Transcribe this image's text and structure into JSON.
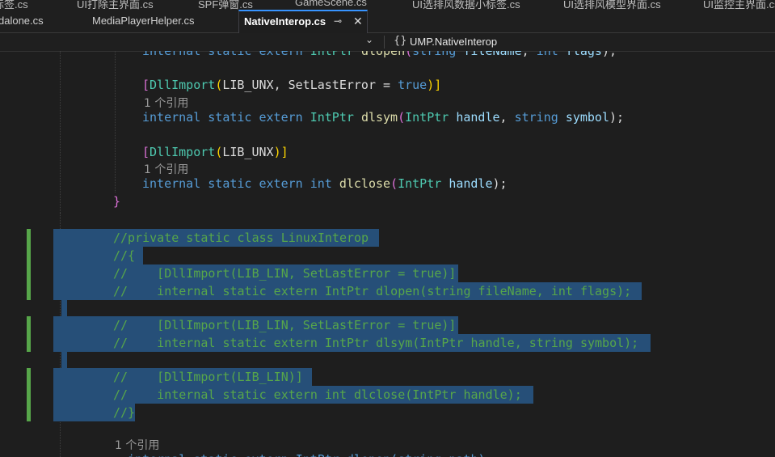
{
  "tabs_row1": [
    "标签.cs",
    "UI打除主界面.cs",
    "SPF弹窗.cs",
    "GameScene.cs",
    "UI选排风数据小标签.cs",
    "UI选排风模型界面.cs",
    "UI监控主界面.cs"
  ],
  "tabs_row2": {
    "tab1": "dalone.cs",
    "tab2": "MediaPlayerHelper.cs",
    "active": "NativeInterop.cs",
    "pin": "⊸",
    "close": "✕"
  },
  "navbar": {
    "dropdown": "⌄",
    "namespace_icon": "{}",
    "namespace": "UMP.NativeInterop"
  },
  "code": {
    "l0": {
      "kw1": "internal",
      "kw2": "static",
      "kw3": "extern",
      "type": "IntPtr",
      "method": "dlopen",
      "p1": "(",
      "kw4": "string",
      "arg1": "fileName",
      "comma": ",",
      "kw5": "int",
      "arg2": "flags",
      "end": ");"
    },
    "l1": {
      "open": "[",
      "attr": "DllImport",
      "p1": "(",
      "lib": "LIB_UNX",
      "comma": ", ",
      "prop": "SetLastError",
      "eq": " = ",
      "val": "true",
      "close": ")]"
    },
    "lens1": "1 个引用",
    "l2": {
      "kw1": "internal",
      "kw2": "static",
      "kw3": "extern",
      "type": "IntPtr",
      "method": "dlsym",
      "p1": "(",
      "type2": "IntPtr",
      "arg1": "handle",
      "comma": ", ",
      "kw4": "string",
      "arg2": "symbol",
      "end": ");"
    },
    "l3": {
      "open": "[",
      "attr": "DllImport",
      "p1": "(",
      "lib": "LIB_UNX",
      "close": ")]"
    },
    "lens2": "1 个引用",
    "l4": {
      "kw1": "internal",
      "kw2": "static",
      "kw3": "extern",
      "kw4": "int",
      "method": "dlclose",
      "p1": "(",
      "type2": "IntPtr",
      "arg1": "handle",
      "end": ");"
    },
    "close_brace": "}",
    "comments": [
      "//private static class LinuxInterop",
      "//{",
      "//    [DllImport(LIB_LIN, SetLastError = true)]",
      "//    internal static extern IntPtr dlopen(string fileName, int flags);",
      "//    [DllImport(LIB_LIN, SetLastError = true)]",
      "//    internal static extern IntPtr dlsym(IntPtr handle, string symbol);",
      "//    [DllImport(LIB_LIN)]",
      "//    internal static extern int dlclose(IntPtr handle);",
      "//}"
    ],
    "lens3": "1 个引用",
    "last_partial": "internal static extern IntPtr dlopen(string path)"
  }
}
